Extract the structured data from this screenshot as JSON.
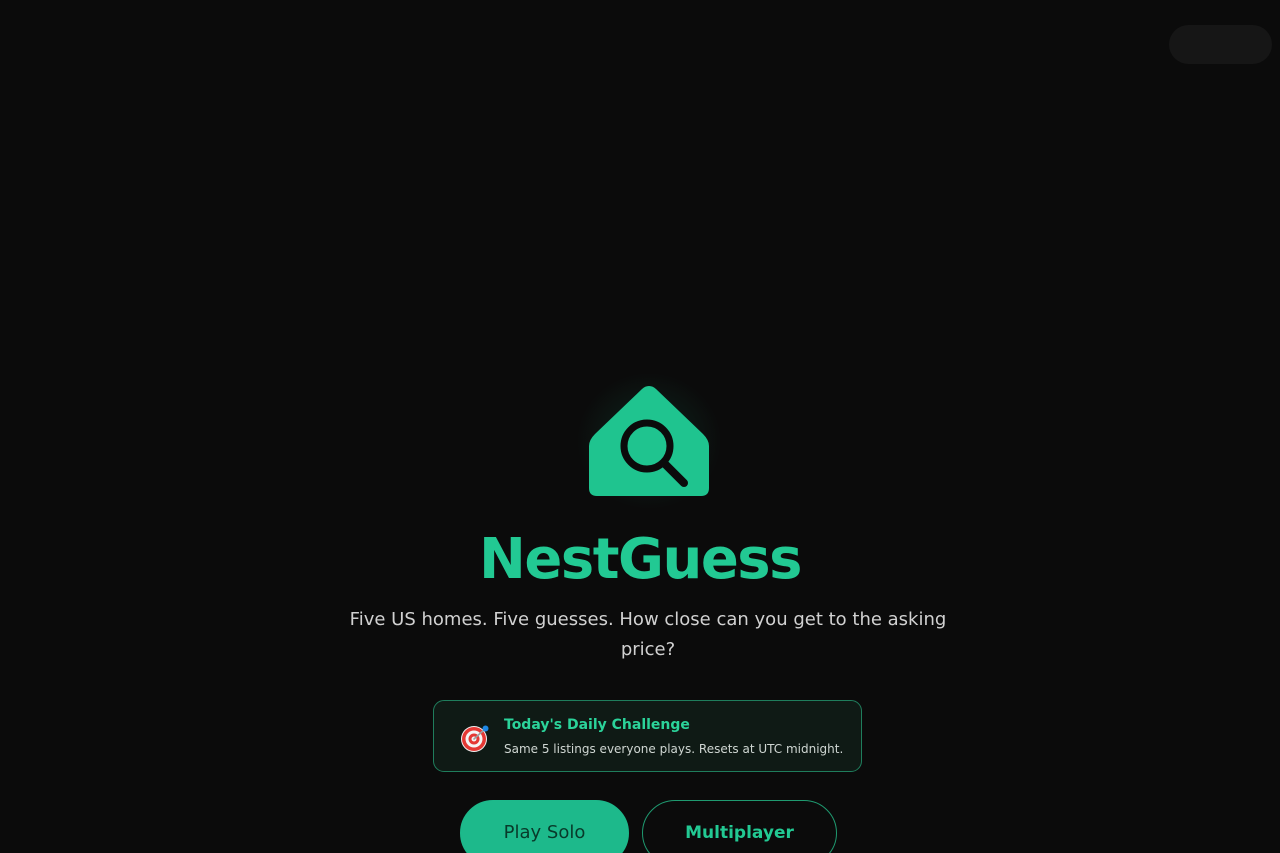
{
  "app": {
    "title": "NestGuess",
    "tagline": "Five US homes. Five guesses. How close can you get to the asking price?",
    "logo_icon": "house-search-icon"
  },
  "colors": {
    "background": "#0b0b0b",
    "accent": "#22c993",
    "card_border": "#1f7d5c",
    "card_background": "#0f1a15"
  },
  "daily_challenge": {
    "icon": "target-icon",
    "title": "Today's Daily Challenge",
    "subtitle": "Same 5 listings everyone plays. Resets at UTC midnight."
  },
  "actions": {
    "play_solo": "Play Solo",
    "multiplayer": "Multiplayer"
  }
}
